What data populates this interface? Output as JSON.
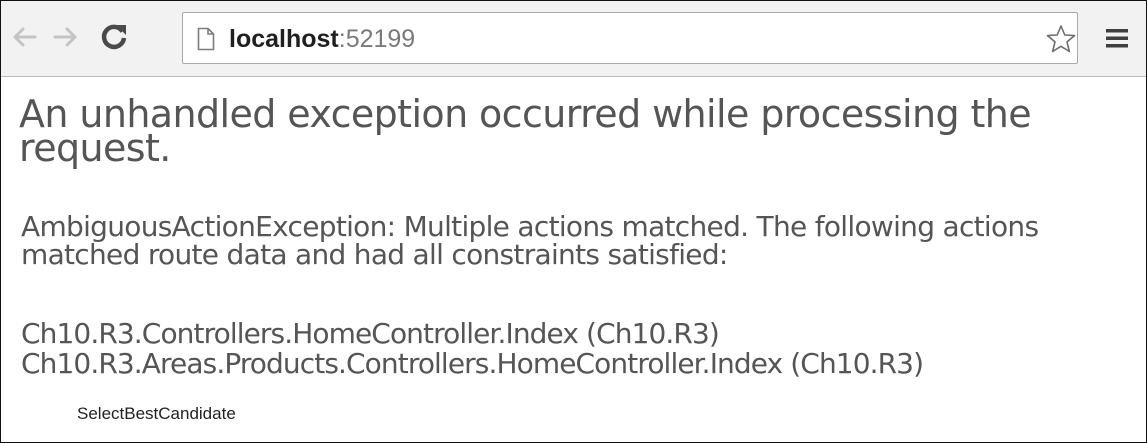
{
  "browser": {
    "url_host": "localhost",
    "url_port": ":52199",
    "icons": {
      "back": "arrow-left-icon",
      "forward": "arrow-right-icon",
      "reload": "reload-icon",
      "page": "page-icon",
      "bookmark": "star-icon",
      "menu": "hamburger-menu-icon"
    }
  },
  "error": {
    "heading": "An unhandled exception occurred while processing the request.",
    "message": "AmbiguousActionException: Multiple actions matched. The following actions matched route data and had all constraints satisfied:",
    "candidates": [
      "Ch10.R3.Controllers.HomeController.Index (Ch10.R3)",
      "Ch10.R3.Areas.Products.Controllers.HomeController.Index (Ch10.R3)"
    ],
    "method": "SelectBestCandidate"
  }
}
